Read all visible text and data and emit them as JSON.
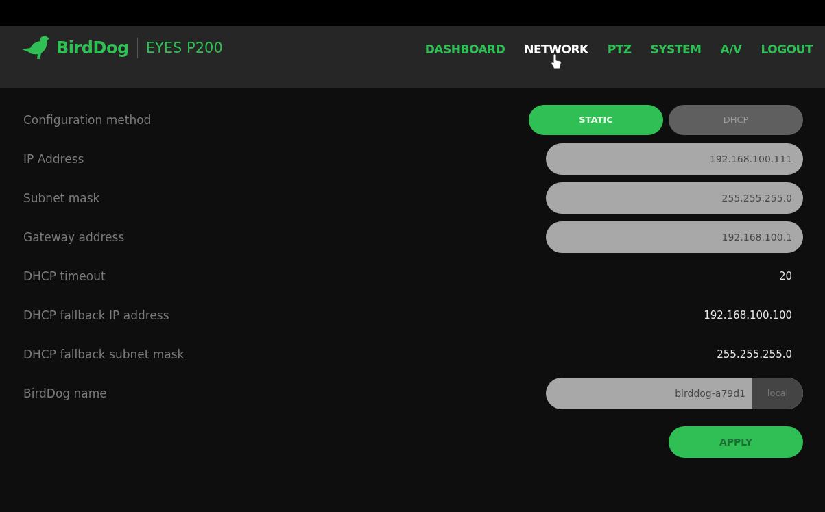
{
  "brand": {
    "name": "BirdDog",
    "model": "EYES P200"
  },
  "nav": [
    {
      "label": "DASHBOARD",
      "selected": false
    },
    {
      "label": "NETWORK",
      "selected": true
    },
    {
      "label": "PTZ",
      "selected": false
    },
    {
      "label": "SYSTEM",
      "selected": false
    },
    {
      "label": "A/V",
      "selected": false
    },
    {
      "label": "LOGOUT",
      "selected": false
    }
  ],
  "settings": [
    {
      "kind": "toggle",
      "label": "Configuration method",
      "options": [
        {
          "label": "STATIC",
          "selected": true
        },
        {
          "label": "DHCP",
          "selected": false
        }
      ]
    },
    {
      "kind": "field",
      "label": "IP Address",
      "value": "192.168.100.111"
    },
    {
      "kind": "field",
      "label": "Subnet mask",
      "value": "255.255.255.0"
    },
    {
      "kind": "field",
      "label": "Gateway address",
      "value": "192.168.100.1"
    },
    {
      "kind": "text",
      "label": "DHCP timeout",
      "value": "20"
    },
    {
      "kind": "text",
      "label": "DHCP fallback IP address",
      "value": "192.168.100.100"
    },
    {
      "kind": "text",
      "label": "DHCP fallback subnet mask",
      "value": "255.255.255.0"
    },
    {
      "kind": "suffix",
      "label": "BirdDog name",
      "value": "birddog-a79d1",
      "suffix": "local"
    }
  ],
  "apply_button": "APPLY"
}
